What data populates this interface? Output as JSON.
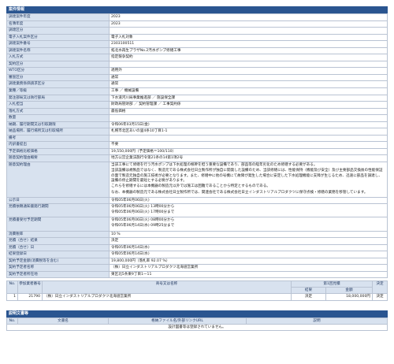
{
  "project": {
    "header": "案件情報",
    "rows": [
      [
        "調達案件年度",
        "2023"
      ],
      [
        "名簿年度",
        "2023"
      ],
      [
        "調達区分",
        ""
      ],
      [
        "電子入札案件区分",
        "電子入札対象"
      ],
      [
        "調達案件番号",
        "2303100511"
      ],
      [
        "調達案件名称",
        "拓北水再生プラザNo.2汚水ポンプ修繕工事"
      ],
      [
        "入札方式",
        "指定競争契約"
      ],
      [
        "契約区分",
        ""
      ],
      [
        "WTO区分",
        "適用外"
      ],
      [
        "審査区分",
        "通常"
      ],
      [
        "調達業務係価請求区分",
        "通常"
      ],
      [
        "業種／等級",
        "工事 ／ 機械設備"
      ],
      [
        "発注部局又は執行部局",
        "下水道河川局事業推進部 ／ 施設保全課"
      ],
      [
        "入札担当",
        "財政局管財部 ／ 契約管理課 ／ 工事契約係"
      ],
      [
        "落札方式",
        "最低価格"
      ],
      [
        "数量",
        ""
      ],
      [
        "納期、履行期間又は引取期限",
        "令和06年03月15日(金)"
      ],
      [
        "納品場所、履行場所又は引取場所",
        "札幌市北区あいの里4条10丁目1-1"
      ],
      [
        "備考",
        ""
      ],
      [
        "内訳書提出",
        "不要"
      ],
      [
        "予定価格比較価格",
        "19,550,000円（予定価格＝100/110）"
      ],
      [
        "随意契約理由概要",
        "地方公営企業法施行令第21条の14第1項2号"
      ]
    ],
    "reason_label": "随意契約理由",
    "reason_lines": [
      "当該工事にて修繕を行う汚水ポンプは下水処理の根幹を担う重要な設備であり、部品等の経年劣化のため修繕する必要がある。",
      "当該設備は規製品ではなく、製造元である株式会社日立製作所が独自に開発した設備のため、当該修繕には、性能保持（機能及び安全）及び主要部品交換後の性能保証の面で製造元独自の施工技術が必要となります。また、修繕中に他の号機にて故障が発生した場合に安定した下水処理機能に支障が生じるため、迅速に部品を調達し、設備の停止期間を最短とする必要があります。",
      "これらを修繕するには本機器の製造元以外では施工は困難であることから特定とするものである。",
      "なお、本機器の製造元である株式会社日立製作所では、関連会社である株式会社日立インダストリアルプロダクツに保守点検・修繕の業務を移管しています。"
    ],
    "rows2": [
      [
        "公示日",
        "令和05年06月06日(火)"
      ],
      [
        "見積依頼通知書発行期間",
        "令和05年06月06日(火) 13時00分から|令和05年06月06日(火) 17時00分まで"
      ],
      [
        "見積書受付予定期間",
        "令和05年06月06日(火) 08時00分から|令和05年06月14日(水) 09時25分まで"
      ],
      [
        "消費税率",
        "10 %"
      ],
      [
        "見積（合せ）結果",
        "決定"
      ],
      [
        "見積（合せ）日",
        "令和05年06月14日(水)"
      ],
      [
        "結果登録日",
        "令和05年06月14日(水)"
      ],
      [
        "契約予定金額(消費税等を含む)",
        "19,800,000円（落札率 92.07 %）"
      ],
      [
        "契約予定者名称",
        "（株）日立インダストリアルプロダクツ北海道営業所"
      ],
      [
        "契約予定者所在地",
        "東区北5条東9丁目1ー11"
      ]
    ]
  },
  "bids": {
    "headers": {
      "no": "No.",
      "code": "参加業者番号",
      "name": "商号又は名称",
      "round": "第1回見積",
      "result": "結果",
      "amount": "金額",
      "decision": "決定"
    },
    "rows": [
      {
        "no": "1",
        "code": "21790",
        "name": "（株）日立インダストリアルプロダクツ北海道営業所",
        "result": "決定",
        "amount": "18,000,000円",
        "decision": "決定"
      }
    ]
  },
  "documents": {
    "header": "説明文書等",
    "col_no": "No.",
    "col_name": "文書名",
    "col_file": "格納ファイル名/外部リンクURL",
    "col_desc": "説明",
    "empty": "設計図書等は登録されていません。"
  }
}
